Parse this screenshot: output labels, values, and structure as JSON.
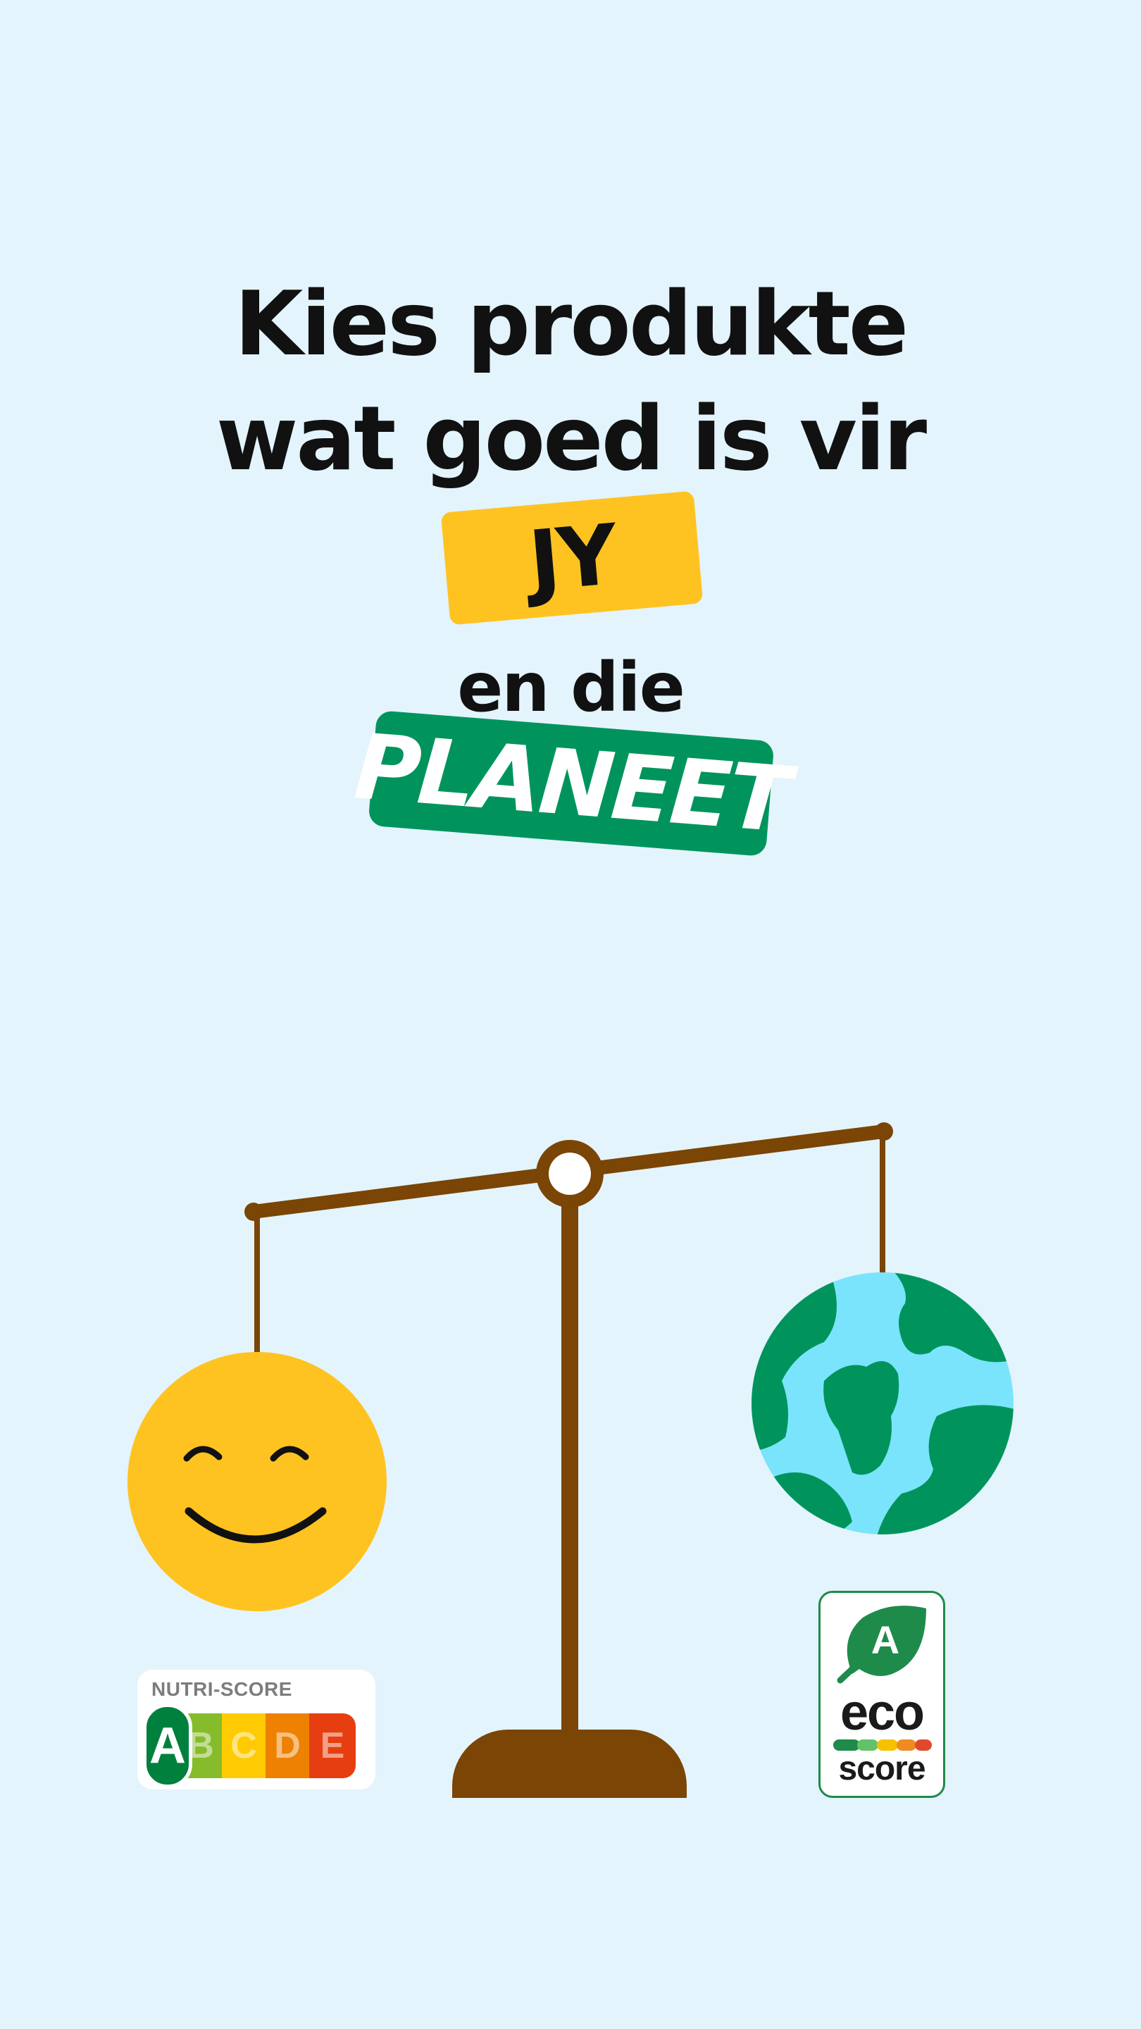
{
  "headline": {
    "line1": "Kies produkte",
    "line2": "wat goed is vir",
    "tag1": "JY",
    "line3": "en die",
    "tag2": "PLANEET"
  },
  "nutri_score": {
    "title": "NUTRI-SCORE",
    "grades": [
      "A",
      "B",
      "C",
      "D",
      "E"
    ],
    "selected": "A",
    "colors": [
      "#00803d",
      "#86bc2b",
      "#fecb02",
      "#ee8100",
      "#e63e11"
    ]
  },
  "eco_score": {
    "grade": "A",
    "word1": "eco",
    "word2": "score",
    "colors": [
      "#1e8b4a",
      "#63c16a",
      "#f6c200",
      "#f08a24",
      "#e04a2a"
    ]
  },
  "colors": {
    "background": "#e3f4fc",
    "scale": "#7a4505",
    "smiley": "#fec321",
    "ocean": "#7ae4fc",
    "land": "#00945c",
    "tag_yellow": "#fec321",
    "tag_green": "#00945c"
  },
  "icons": {
    "scale": "balance-scale-icon",
    "smiley": "smiling-face-icon",
    "globe": "earth-globe-icon",
    "leaf": "leaf-icon"
  }
}
